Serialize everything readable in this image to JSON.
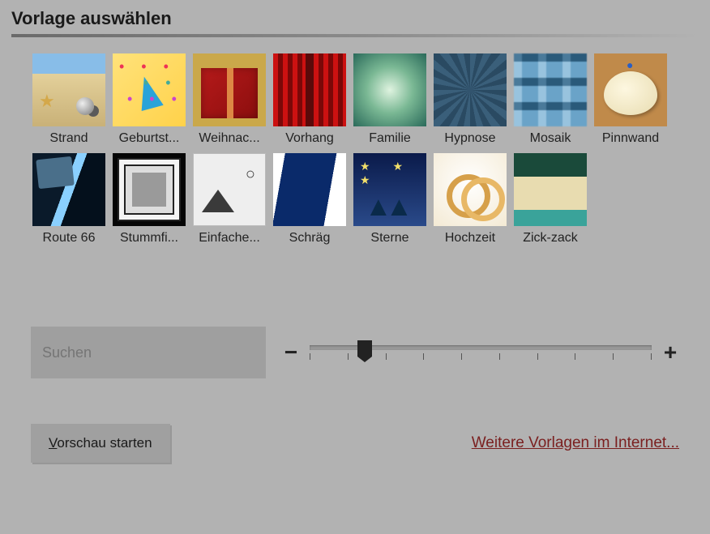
{
  "title": "Vorlage auswählen",
  "templates": [
    {
      "id": "strand",
      "label": "Strand"
    },
    {
      "id": "geburtstag",
      "label": "Geburtst..."
    },
    {
      "id": "weihnachten",
      "label": "Weihnac..."
    },
    {
      "id": "vorhang",
      "label": "Vorhang"
    },
    {
      "id": "familie",
      "label": "Familie"
    },
    {
      "id": "hypnose",
      "label": "Hypnose"
    },
    {
      "id": "mosaik",
      "label": "Mosaik"
    },
    {
      "id": "pinnwand",
      "label": "Pinnwand"
    },
    {
      "id": "route66",
      "label": "Route 66"
    },
    {
      "id": "stummfilm",
      "label": "Stummfi..."
    },
    {
      "id": "einfache",
      "label": "Einfache..."
    },
    {
      "id": "schraeg",
      "label": "Schräg"
    },
    {
      "id": "sterne",
      "label": "Sterne"
    },
    {
      "id": "hochzeit",
      "label": "Hochzeit"
    },
    {
      "id": "zickzack",
      "label": "Zick-zack"
    }
  ],
  "search": {
    "placeholder": "Suchen"
  },
  "slider": {
    "minus": "−",
    "plus": "+",
    "value_percent": 16,
    "ticks": 10
  },
  "buttons": {
    "preview_prefix_underlined": "V",
    "preview_rest": "orschau starten"
  },
  "links": {
    "more_templates": "Weitere Vorlagen im Internet..."
  }
}
